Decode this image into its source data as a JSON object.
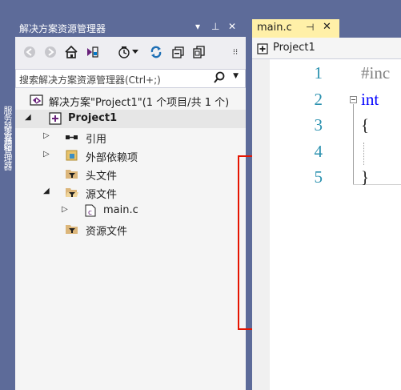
{
  "left_strip": {
    "tab1": "服务器资源管理器",
    "tab2": "工具箱"
  },
  "solution_explorer": {
    "title": "解决方案资源管理器",
    "title_buttons": {
      "dropdown": "▾",
      "pin": "⊥",
      "close": "✕"
    },
    "search_placeholder": "搜索解决方案资源管理器(Ctrl+;)",
    "tree": [
      {
        "label": "解决方案\"Project1\"(1 个项目/共 1 个)",
        "icon": "solution-icon",
        "expander": ""
      },
      {
        "label": "Project1",
        "icon": "cpp-project-icon",
        "expander": "◢",
        "bold": true
      },
      {
        "label": "引用",
        "icon": "references-icon",
        "expander": "▷"
      },
      {
        "label": "外部依赖项",
        "icon": "external-deps-icon",
        "expander": "▷"
      },
      {
        "label": "头文件",
        "icon": "filter-folder-icon",
        "expander": ""
      },
      {
        "label": "源文件",
        "icon": "filter-folder-open-icon",
        "expander": "◢"
      },
      {
        "label": "main.c",
        "icon": "c-file-icon",
        "expander": "▷"
      },
      {
        "label": "资源文件",
        "icon": "filter-folder-icon",
        "expander": ""
      }
    ]
  },
  "editor": {
    "tab_label": "main.c",
    "tab_pin": "⊣",
    "tab_close": "✕",
    "nav_project": "Project1",
    "line_numbers": [
      "1",
      "2",
      "3",
      "4",
      "5"
    ],
    "lines": {
      "l1": "#inc",
      "l2": "int",
      "l3": "{",
      "l5": "}"
    }
  },
  "colors": {
    "chrome": "#5d6b99",
    "active_tab": "#fff0a8",
    "line_number": "#2b91af",
    "keyword": "#0000ff",
    "highlight_box": "#e51400"
  }
}
